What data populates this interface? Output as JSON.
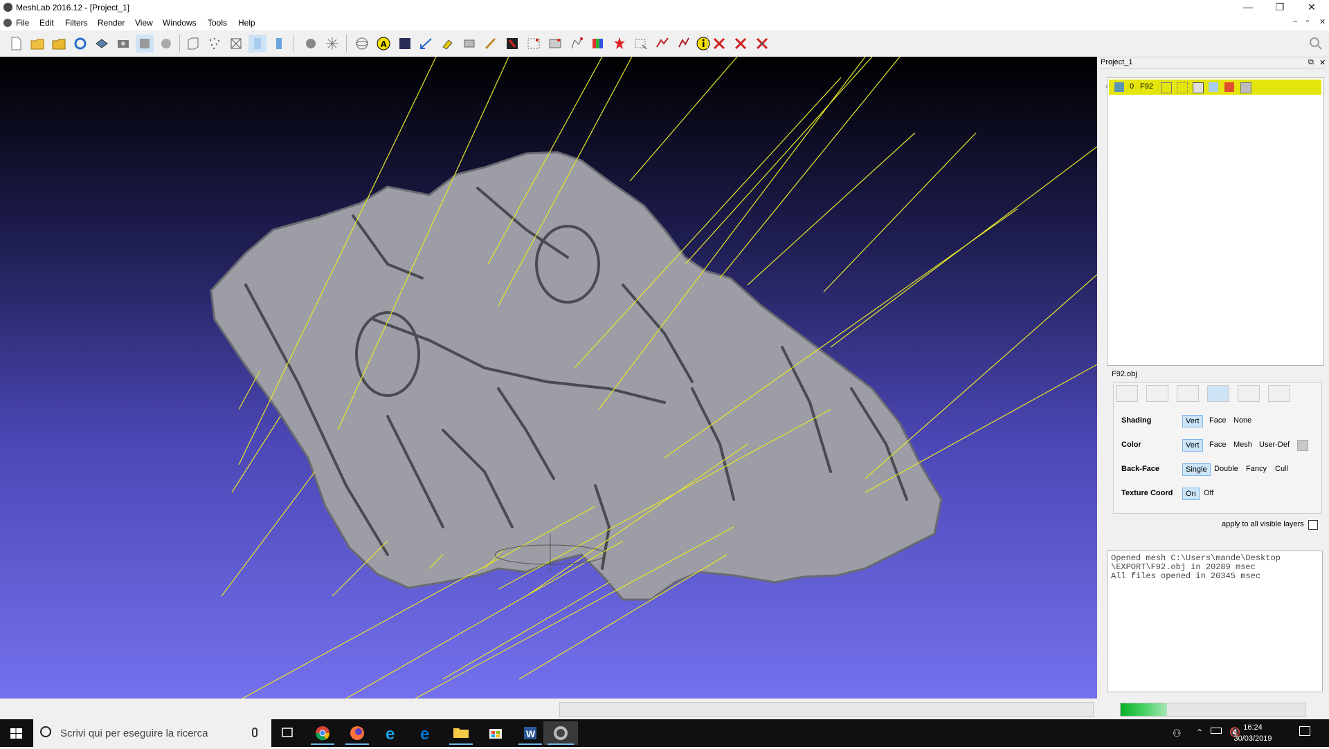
{
  "window": {
    "title": "MeshLab 2016.12 - [Project_1]",
    "controls": {
      "minimize": "—",
      "restore": "❐",
      "close": "✕"
    }
  },
  "menu": {
    "items": [
      "File",
      "Edit",
      "Filters",
      "Render",
      "View",
      "Windows",
      "Tools",
      "Help"
    ],
    "mdi": {
      "minimize": "–",
      "restore": "▫",
      "close": "✕"
    }
  },
  "toolbar": {
    "icons": [
      "new-project-icon",
      "open-project-icon",
      "open-mesh-icon",
      "reload-icon",
      "save-icon",
      "snapshot-icon",
      "layers-icon",
      "grid-icon",
      "bounding-box-icon",
      "points-icon",
      "wireframe-icon",
      "flat-lines-icon",
      "flat-icon",
      "smooth-icon",
      "light-icon",
      "trackball-icon",
      "axis-icon",
      "info-icon",
      "ambient-icon",
      "measure-icon",
      "paint-icon",
      "select-vertices-icon",
      "camera-icon",
      "brush-icon",
      "color-paint-icon",
      "select-faces-icon",
      "select-connected-icon",
      "rgb-icon",
      "georef-icon",
      "align-icon",
      "points-picker-icon",
      "delete-icon",
      "about-icon",
      "delete-faces-icon",
      "delete-vertices-icon",
      "delete-both-icon"
    ]
  },
  "panel": {
    "project_title": "Project_1",
    "layer": {
      "index": "0",
      "name": "F92"
    },
    "mesh_label": "F92.obj",
    "decorator_tabs": [
      "bounding-box-tab",
      "points-tab",
      "wireframe-tab",
      "color-tab",
      "paint-tab",
      "texture-tab"
    ],
    "shading": {
      "label": "Shading",
      "options": [
        "Vert",
        "Face",
        "None"
      ],
      "selected": "Vert"
    },
    "color": {
      "label": "Color",
      "options": [
        "Vert",
        "Face",
        "Mesh",
        "User-Def"
      ],
      "selected": "Vert",
      "swatch": "#c8c8c8"
    },
    "backface": {
      "label": "Back-Face",
      "options": [
        "Single",
        "Double",
        "Fancy",
        "Cull"
      ],
      "selected": "Single"
    },
    "texcoord": {
      "label": "Texture Coord",
      "options": [
        "On",
        "Off"
      ],
      "selected": "On"
    },
    "apply_all": "apply to all visible layers",
    "log": "Opened mesh C:\\Users\\mande\\Desktop\n\\EXPORT\\F92.obj in 20289 msec\nAll files opened in 20345 msec"
  },
  "status": {
    "progress": 0.25,
    "accent": "#06b025"
  },
  "taskbar": {
    "search_placeholder": "Scrivi qui per eseguire la ricerca",
    "apps": [
      "task-view-icon",
      "chrome-icon",
      "firefox-icon",
      "ie-icon",
      "edge-icon",
      "explorer-icon",
      "store-icon",
      "word-icon",
      "meshlab-icon"
    ],
    "time": "16:24",
    "date": "30/03/2019"
  },
  "viewport": {
    "bg_top": "#000000",
    "bg_bottom": "#7471ee",
    "line_color": "#e8e826",
    "mesh_color": "#9d9da5"
  }
}
